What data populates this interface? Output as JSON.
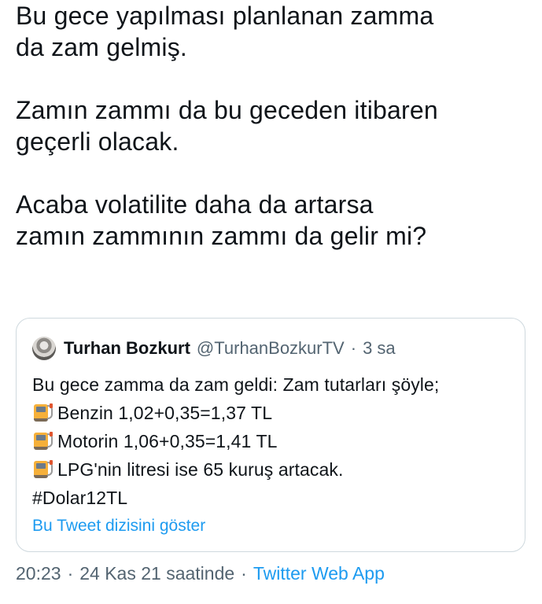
{
  "tweet": {
    "paragraphs": [
      [
        "Bu gece yapılması planlanan zamma",
        "da zam gelmiş."
      ],
      [
        "Zamın zammı da bu geceden itibaren",
        "geçerli olacak."
      ],
      [
        "Acaba volatilite daha da artarsa",
        "zamın zammının zammı da gelir mi?"
      ]
    ]
  },
  "quote": {
    "author_name": "Turhan Bozkurt",
    "handle": "@TurhanBozkurTV",
    "separator": "·",
    "time": "3 sa",
    "lines": [
      "Bu gece zamma da zam geldi: Zam tutarları şöyle;",
      "Benzin 1,02+0,35=1,37 TL",
      "Motorin 1,06+0,35=1,41 TL",
      "LPG'nin litresi ise 65 kuruş artacak.",
      "#Dolar12TL"
    ],
    "line_icons": [
      "",
      "fuel-pump-icon",
      "fuel-pump-icon",
      "fuel-pump-icon",
      ""
    ],
    "show_thread": "Bu Tweet dizisini göster"
  },
  "meta": {
    "time": "20:23",
    "separator": "·",
    "date": "24 Kas 21 saatinde",
    "separator2": "·",
    "source": "Twitter Web App"
  },
  "colors": {
    "text": "#0f1419",
    "secondary": "#536471",
    "link": "#1d9bf0",
    "border": "#cfd9de"
  }
}
